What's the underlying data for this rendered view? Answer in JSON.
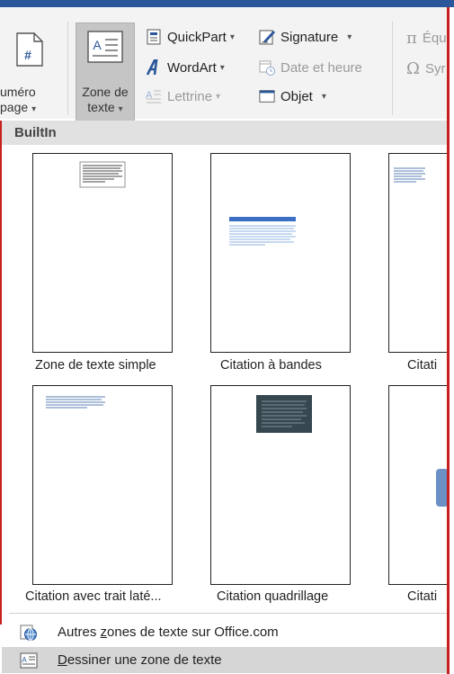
{
  "ribbon": {
    "numero_label_1": "uméro",
    "numero_label_2": "page",
    "zone_label_1": "Zone de",
    "zone_label_2": "texte",
    "quickpart": "QuickPart",
    "wordart": "WordArt",
    "lettrine": "Lettrine",
    "signature": "Signature",
    "date_heure": "Date et heure",
    "objet": "Objet",
    "equation": "Équ",
    "symbole": "Syr",
    "caret": "▾"
  },
  "section_header": "BuiltIn",
  "gallery": {
    "items": [
      {
        "label": "Zone de texte simple"
      },
      {
        "label": "Citation à bandes"
      },
      {
        "label": "Citati"
      },
      {
        "label": "Citation avec trait laté..."
      },
      {
        "label": "Citation quadrillage"
      },
      {
        "label": "Citati"
      }
    ]
  },
  "menu": {
    "more_prefix": "Autres ",
    "more_accel": "z",
    "more_suffix": "ones de texte sur Office.com",
    "draw_accel": "D",
    "draw_suffix": "essiner une zone de texte"
  },
  "colors": {
    "title_bar": "#2b579a",
    "accent_red": "#c8201f",
    "thumb_blue": "#3a6fc4",
    "quad_dark": "#37474f"
  }
}
